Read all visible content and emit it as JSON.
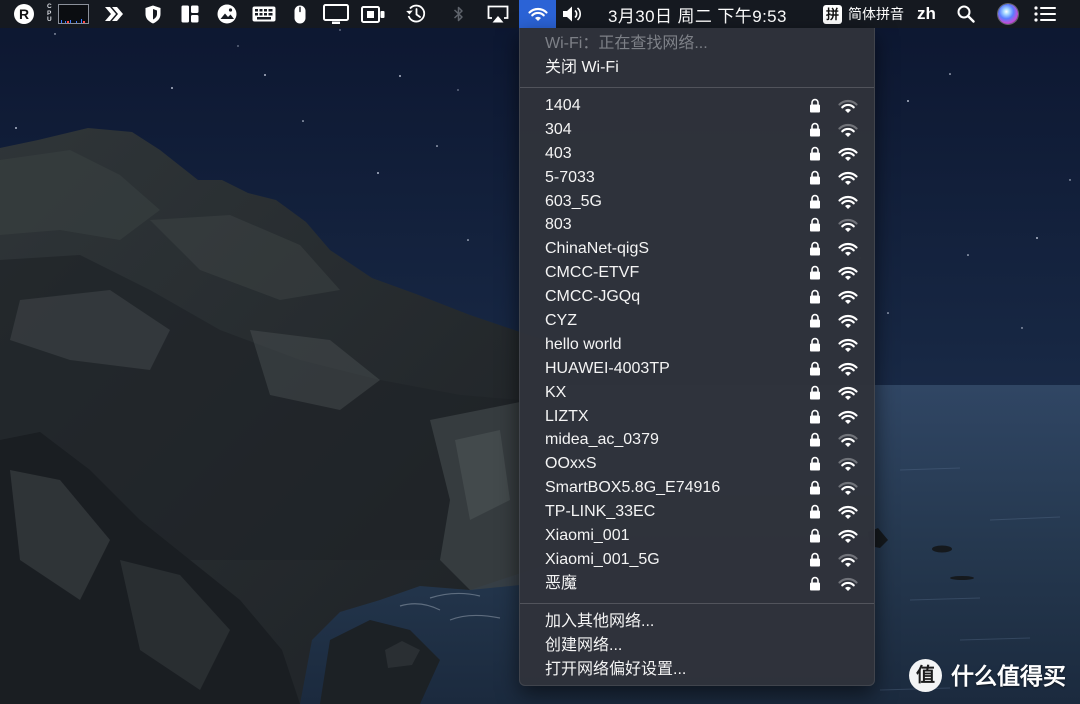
{
  "menubar": {
    "app_icon_letter": "R",
    "cpu_label": "CPU",
    "clock": "3月30日 周二 下午9:53",
    "input_method_glyph": "拼",
    "input_method_name": "简体拼音",
    "language": "zh",
    "icons": [
      "app-r-icon",
      "cpu-monitor",
      "chevrons-icon",
      "shield-icon",
      "window-layout-icon",
      "photo-icon",
      "keyboard-icon",
      "mouse-icon",
      "display-icon",
      "screen-record-icon",
      "time-machine-icon",
      "bluetooth-icon",
      "airplay-icon",
      "wifi-icon",
      "volume-icon",
      "input-method-icon",
      "search-icon",
      "siri-icon",
      "notification-center-icon"
    ]
  },
  "wifi_menu": {
    "status": "Wi-Fi：正在查找网络...",
    "toggle_label": "关闭 Wi-Fi",
    "signal_max": 3,
    "networks": [
      {
        "name": "1404",
        "secured": true,
        "signal": 2
      },
      {
        "name": "304",
        "secured": true,
        "signal": 2
      },
      {
        "name": "403",
        "secured": true,
        "signal": 3
      },
      {
        "name": "5-7033",
        "secured": true,
        "signal": 3
      },
      {
        "name": "603_5G",
        "secured": true,
        "signal": 3
      },
      {
        "name": "803",
        "secured": true,
        "signal": 2
      },
      {
        "name": "ChinaNet-qigS",
        "secured": true,
        "signal": 3
      },
      {
        "name": "CMCC-ETVF",
        "secured": true,
        "signal": 3
      },
      {
        "name": "CMCC-JGQq",
        "secured": true,
        "signal": 3
      },
      {
        "name": "CYZ",
        "secured": true,
        "signal": 3
      },
      {
        "name": "hello world",
        "secured": true,
        "signal": 3
      },
      {
        "name": "HUAWEI-4003TP",
        "secured": true,
        "signal": 3
      },
      {
        "name": "KX",
        "secured": true,
        "signal": 3
      },
      {
        "name": "LIZTX",
        "secured": true,
        "signal": 3
      },
      {
        "name": "midea_ac_0379",
        "secured": true,
        "signal": 2
      },
      {
        "name": "OOxxS",
        "secured": true,
        "signal": 2
      },
      {
        "name": "SmartBOX5.8G_E74916",
        "secured": true,
        "signal": 2
      },
      {
        "name": "TP-LINK_33EC",
        "secured": true,
        "signal": 3
      },
      {
        "name": "Xiaomi_001",
        "secured": true,
        "signal": 3
      },
      {
        "name": "Xiaomi_001_5G",
        "secured": true,
        "signal": 2
      },
      {
        "name": "恶魔",
        "secured": true,
        "signal": 2
      }
    ],
    "actions": [
      "加入其他网络...",
      "创建网络...",
      "打开网络偏好设置..."
    ]
  },
  "watermark": {
    "logo_glyph": "值",
    "text": "什么值得买"
  },
  "colors": {
    "menubar_bg": "#151920",
    "menu_bg": "#2f333b",
    "wifi_highlight": "#2b63d6",
    "dim_text": "#7d8087",
    "text": "#f4f4f4",
    "signal_dim": "rgba(255,255,255,0.32)"
  }
}
